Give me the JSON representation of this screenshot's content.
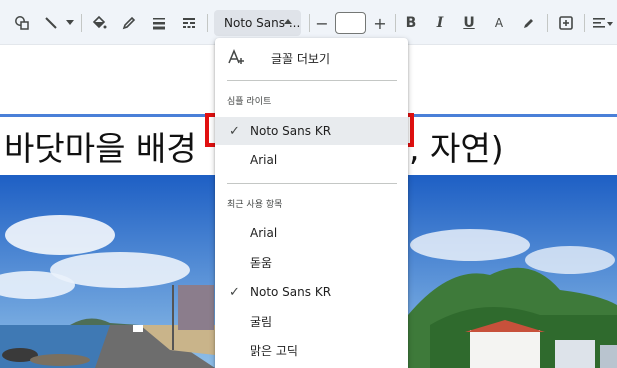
{
  "toolbar": {
    "font_name": "Noto Sans ...",
    "size_value": "",
    "icons": [
      "shapes-icon",
      "line-icon",
      "chevron-down-icon",
      "fill-color-icon",
      "border-color-icon",
      "border-weight-icon",
      "border-dash-icon",
      "decrease-size-icon",
      "increase-size-icon",
      "bold-icon",
      "italic-icon",
      "underline-icon",
      "text-color-icon",
      "highlight-icon",
      "insert-comment-icon",
      "align-icon"
    ],
    "bold": "B",
    "italic": "I",
    "underline": "U",
    "text_color": "A",
    "minus": "−",
    "plus": "+"
  },
  "slide": {
    "title_left": "바닷마을 배경",
    "title_right": ", 자연)"
  },
  "font_menu": {
    "more_fonts": "글꼴 더보기",
    "theme_header": "심플 라이트",
    "theme_fonts": [
      {
        "label": "Noto Sans KR",
        "checked": true,
        "selected": true
      },
      {
        "label": "Arial",
        "checked": false
      }
    ],
    "recent_header": "최근 사용 항목",
    "recent_fonts": [
      {
        "label": "Arial",
        "checked": false
      },
      {
        "label": "돋움",
        "checked": false
      },
      {
        "label": "Noto Sans KR",
        "checked": true
      },
      {
        "label": "굴림",
        "checked": false
      },
      {
        "label": "맑은 고딕",
        "checked": false
      }
    ],
    "check_glyph": "✓"
  },
  "colors": {
    "highlight_box": "#e11010",
    "selection_line": "#4a80d8",
    "toolbar_bg": "#f0f4f9"
  }
}
